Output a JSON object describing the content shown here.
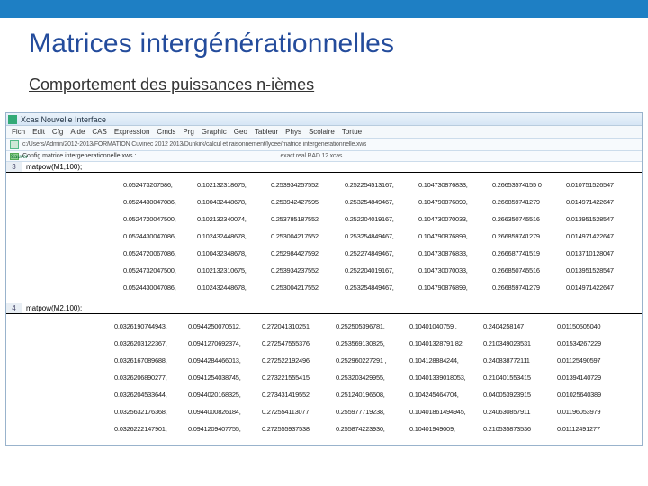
{
  "slide": {
    "title": "Matrices intergénérationnelles",
    "subtitle": "Comportement des puissances n-ièmes"
  },
  "app": {
    "title": "Xcas Nouvelle Interface",
    "menu": [
      "Fich",
      "Edit",
      "Cfg",
      "Aide",
      "CAS",
      "Expression",
      "Cmds",
      "Prg",
      "Graphic",
      "Geo",
      "Tableur",
      "Phys",
      "Scolaire",
      "Tortue"
    ],
    "filepath": "c:/Users/Admin/2012-2013/FORMATION Cuvinec 2012 2013/Dunkirk/calcul et raisonnement/lycee/matrice intergenerationnelle.xws",
    "savebtn": "Sauver",
    "config_label": "Config matrice intergenerationnelle.xws :",
    "config_value": "exact real RAD 12 xcas"
  },
  "cmd1": {
    "num": "3",
    "text": "matpow(M1,100);"
  },
  "matrix1": [
    [
      "0.052473207586,",
      "0.102132318675,",
      "0.253934257552",
      "0.252254513167,",
      "0.104730876833,",
      "0.26653574155 0",
      "0.010751526547"
    ],
    [
      "0.0524430047086,",
      "0.100432448678,",
      "0.253942427595",
      "0.253254849467,",
      "0.104790876899,",
      "0.266859741279",
      "0.014971422647"
    ],
    [
      "0.0524720047500,",
      "0.102132340074,",
      "0.253785187552",
      "0.252204019167,",
      "0.104730070033,",
      "0.266350745516",
      "0.013951528547"
    ],
    [
      "0.0524430047086,",
      "0.102432448678,",
      "0.253004217552",
      "0.253254849467,",
      "0.104790876899,",
      "0.266859741279",
      "0.014971422647"
    ],
    [
      "0.0524720067086,",
      "0.100432348678,",
      "0.252984427592",
      "0.252274849467,",
      "0.104730876833,",
      "0.266687741519",
      "0.013710128047"
    ],
    [
      "0.0524732047500,",
      "0.102132310675,",
      "0.253934237552",
      "0.252204019167,",
      "0.104730070033,",
      "0.266850745516",
      "0.013951528547"
    ],
    [
      "0.0524430047086,",
      "0.102432448678,",
      "0.253004217552",
      "0.253254849467,",
      "0.104790876899,",
      "0.266859741279",
      "0.014971422647"
    ]
  ],
  "cmd2": {
    "num": "4",
    "text": "matpow(M2,100);"
  },
  "matrix2": [
    [
      "0.0326190744943,",
      "0.0944250070512,",
      "0.272041310251",
      "0.252505396781,",
      "0.10401040759 ,",
      "0.2404258147",
      "0.01150505040"
    ],
    [
      "0.0326203122367,",
      "0.0941270692374,",
      "0.272547555376",
      "0.253569130825,",
      "0.10401328791 82,",
      "0.210349023531",
      "0.01534267229"
    ],
    [
      "0.0326167089688,",
      "0.0944284466013,",
      "0.272522192496",
      "0.252960227291 ,",
      "0.104128884244,",
      "0.240838772111",
      "0.01125490597"
    ],
    [
      "0.0326206890277,",
      "0.0941254038745,",
      "0.273221555415",
      "0.253203429955,",
      "0.10401339018053,",
      "0.210401553415",
      "0.01394140729"
    ],
    [
      "0.0326204533644,",
      "0.0944020168325,",
      "0.273431419552",
      "0.251240196508,",
      "0.104245464704,",
      "0.040053923915",
      "0.01025640389"
    ],
    [
      "0.0325632176368,",
      "0.0944000826184,",
      "0.272554113077",
      "0.255977719238,",
      "0.10401861494945,",
      "0.240630857911",
      "0.01196053979"
    ],
    [
      "0.0326222147901,",
      "0.0941209407755,",
      "0.272555937538",
      "0.255874223930,",
      "0.10401949009,",
      "0.210535873536",
      "0.01112491277"
    ]
  ]
}
